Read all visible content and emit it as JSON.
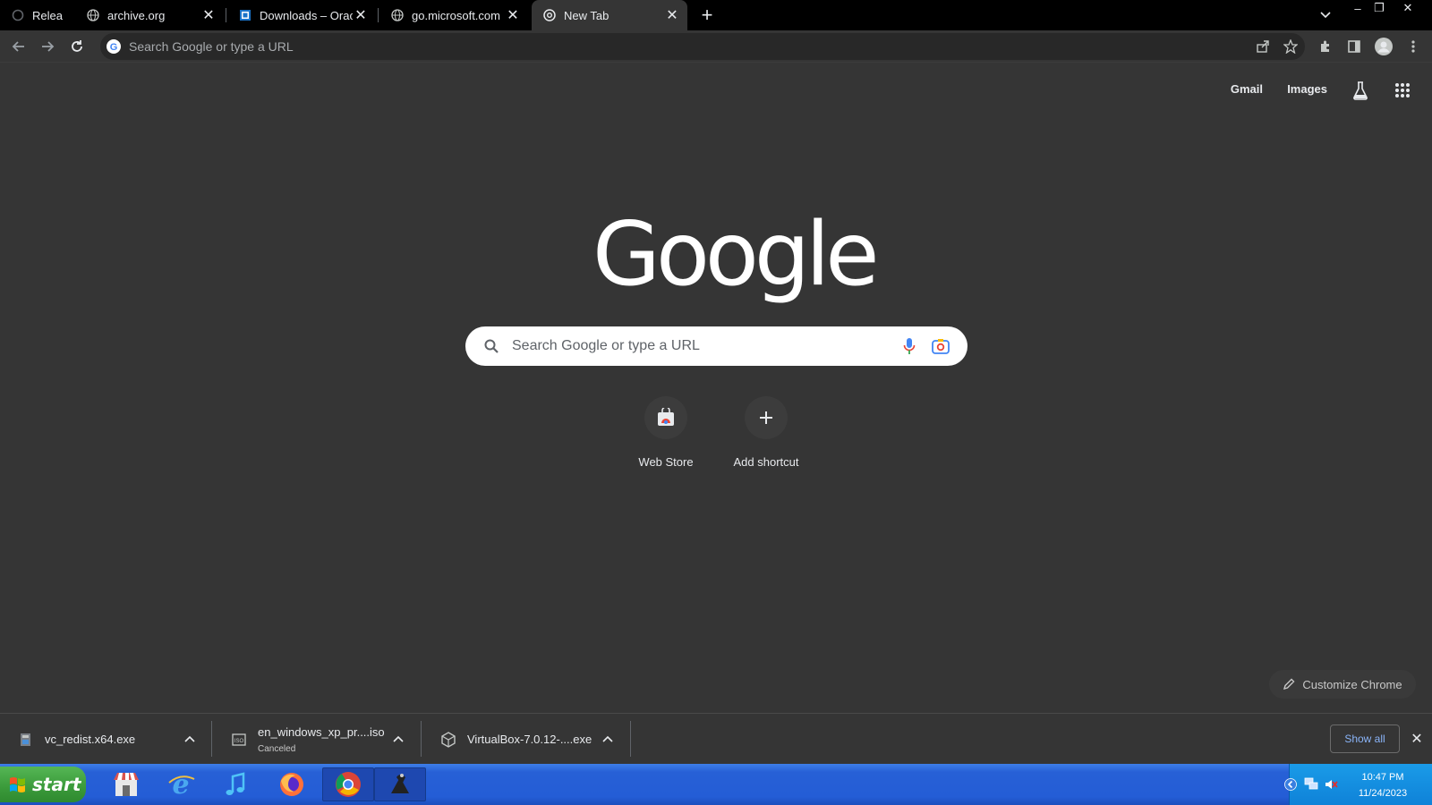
{
  "tabs": [
    {
      "title": "Relea",
      "active": false
    },
    {
      "title": "archive.org",
      "active": false
    },
    {
      "title": "Downloads – Oracle",
      "active": false
    },
    {
      "title": "go.microsoft.com",
      "active": false
    },
    {
      "title": "New Tab",
      "active": true
    }
  ],
  "omnibox": {
    "placeholder": "Search Google or type a URL"
  },
  "top_links": {
    "gmail": "Gmail",
    "images": "Images"
  },
  "logo_text": "Google",
  "search": {
    "placeholder": "Search Google or type a URL"
  },
  "shortcuts": [
    {
      "label": "Web Store"
    },
    {
      "label": "Add shortcut"
    }
  ],
  "customize_label": "Customize Chrome",
  "downloads": [
    {
      "name": "vc_redist.x64.exe",
      "status": ""
    },
    {
      "name": "en_windows_xp_pr....iso",
      "status": "Canceled"
    },
    {
      "name": "VirtualBox-7.0.12-....exe",
      "status": ""
    }
  ],
  "show_all_label": "Show all",
  "taskbar": {
    "start_label": "start",
    "apps": [
      "store-icon",
      "internet-explorer-icon",
      "itunes-icon",
      "firefox-icon",
      "chrome-icon",
      "app-icon"
    ]
  },
  "clock": {
    "time": "10:47 PM",
    "date": "11/24/2023"
  },
  "colors": {
    "accent": "#8ab4f8",
    "background": "#353535",
    "taskbar": "#245dd6",
    "start": "#3a9a3a"
  }
}
